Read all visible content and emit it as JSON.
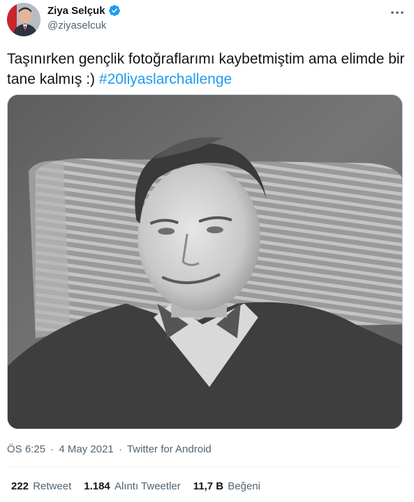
{
  "author": {
    "display_name": "Ziya Selçuk",
    "handle": "@ziyaselcuk",
    "verified_icon": "verified-badge-icon",
    "more_icon": "more-horizontal-icon"
  },
  "tweet": {
    "text": "Taşınırken gençlik fotoğraflarımı kaybetmiştim ama elimde bir tane kalmış :) ",
    "hashtag": "#20liyaslarchallenge",
    "photo": "black-and-white-portrait-photo"
  },
  "meta": {
    "time": "ÖS 6:25",
    "separator1": "·",
    "date": "4 May 2021",
    "separator2": "·",
    "source": "Twitter for Android"
  },
  "stats": {
    "retweets": {
      "count": "222",
      "label": "Retweet"
    },
    "quotes": {
      "count": "1.184",
      "label": "Alıntı Tweetler"
    },
    "likes": {
      "count": "11,7 B",
      "label": "Beğeni"
    }
  },
  "colors": {
    "accent": "#1d9bf0",
    "text": "#0f1419",
    "secondary": "#536471",
    "border": "#eff3f4"
  }
}
